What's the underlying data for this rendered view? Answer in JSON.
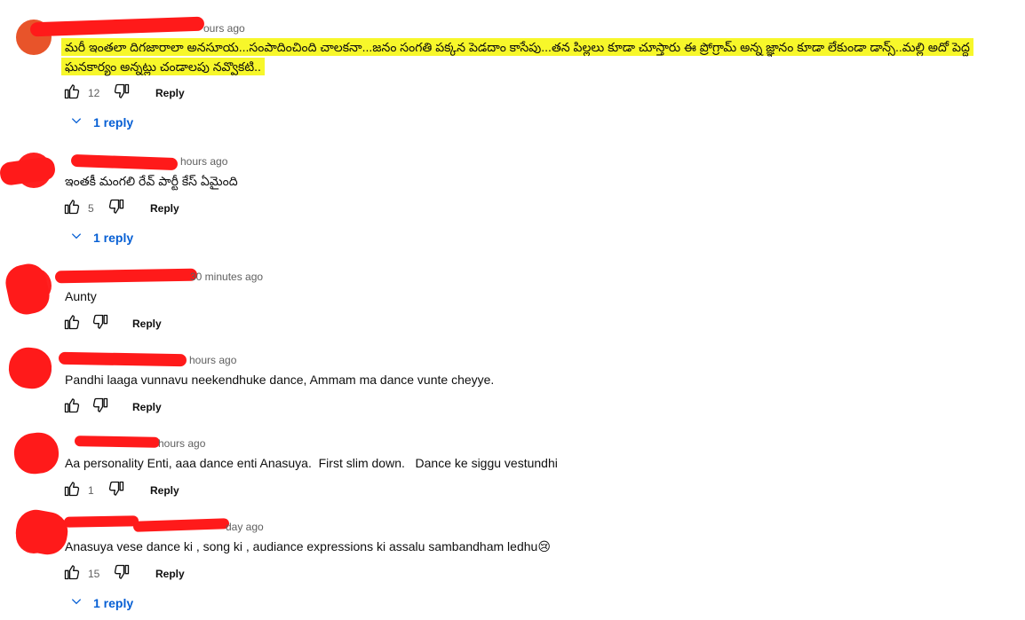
{
  "comments": [
    {
      "time": "ours ago",
      "text": "మరీ ఇంతలా దిగజారాలా అనసూయ...సంపాదించింది చాలకనా...జనం సంగతి పక్కన పెడదాం కాసేపు...తన పిల్లలు కూడా చూస్తారు ఈ ప్రోగ్రామ్ అన్న జ్ఞానం కూడా లేకుండా డాన్స్..మల్లి అదో పెద్ద ఘనకార్యం అన్నట్లు చండాలపు నవ్వొకటి..",
      "likes": "12",
      "reply_label": "Reply",
      "replies_label": "1 reply"
    },
    {
      "time": "hours ago",
      "text": "ఇంతకీ మంగలి రేవ్ పార్టీ కేస్ ఏమైంది",
      "likes": "5",
      "reply_label": "Reply",
      "replies_label": "1 reply"
    },
    {
      "time": "30 minutes ago",
      "text": "Aunty",
      "likes": "",
      "reply_label": "Reply"
    },
    {
      "time": "hours ago",
      "text": "Pandhi laaga vunnavu neekendhuke dance, Ammam ma dance vunte cheyye.",
      "likes": "",
      "reply_label": "Reply"
    },
    {
      "time": "hours ago",
      "text": "Aa personality Enti, aaa dance enti Anasuya.  First slim down.   Dance ke siggu vestundhi",
      "likes": "1",
      "reply_label": "Reply"
    },
    {
      "time": "day ago",
      "text": "Anasuya vese dance ki , song ki , audiance expressions ki assalu sambandham ledhu",
      "emoji": "😢",
      "likes": "15",
      "reply_label": "Reply",
      "replies_label": "1 reply"
    }
  ],
  "colors": {
    "link": "#065fd4",
    "highlight": "#f7f72a",
    "redaction": "#ff1a1a",
    "meta": "#606060"
  },
  "icons": [
    "thumbs-up-icon",
    "thumbs-down-icon",
    "chevron-down-icon"
  ]
}
